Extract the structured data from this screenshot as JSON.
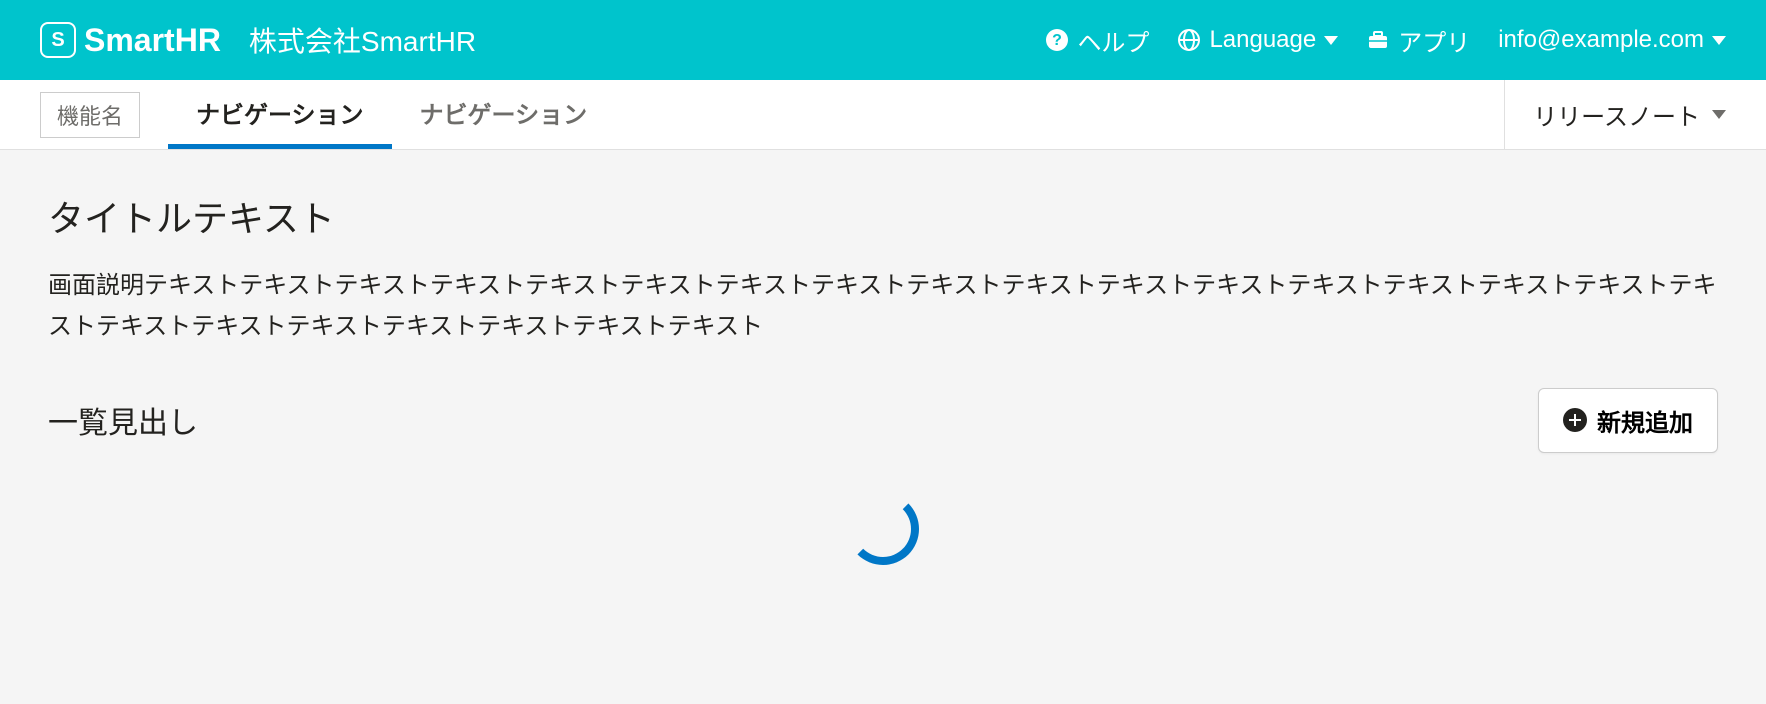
{
  "header": {
    "logo_text": "SmartHR",
    "company_name": "株式会社SmartHR",
    "help_label": "ヘルプ",
    "language_label": "Language",
    "apps_label": "アプリ",
    "user_email": "info@example.com"
  },
  "subnav": {
    "feature_badge": "機能名",
    "tabs": [
      {
        "label": "ナビゲーション",
        "active": true
      },
      {
        "label": "ナビゲーション",
        "active": false
      }
    ],
    "release_notes_label": "リリースノート"
  },
  "main": {
    "title": "タイトルテキスト",
    "description": "画面説明テキストテキストテキストテキストテキストテキストテキストテキストテキストテキストテキストテキストテキストテキストテキストテキストテキストテキストテキストテキストテキストテキストテキストテキスト",
    "list_heading": "一覧見出し",
    "add_button_label": "新規追加"
  }
}
